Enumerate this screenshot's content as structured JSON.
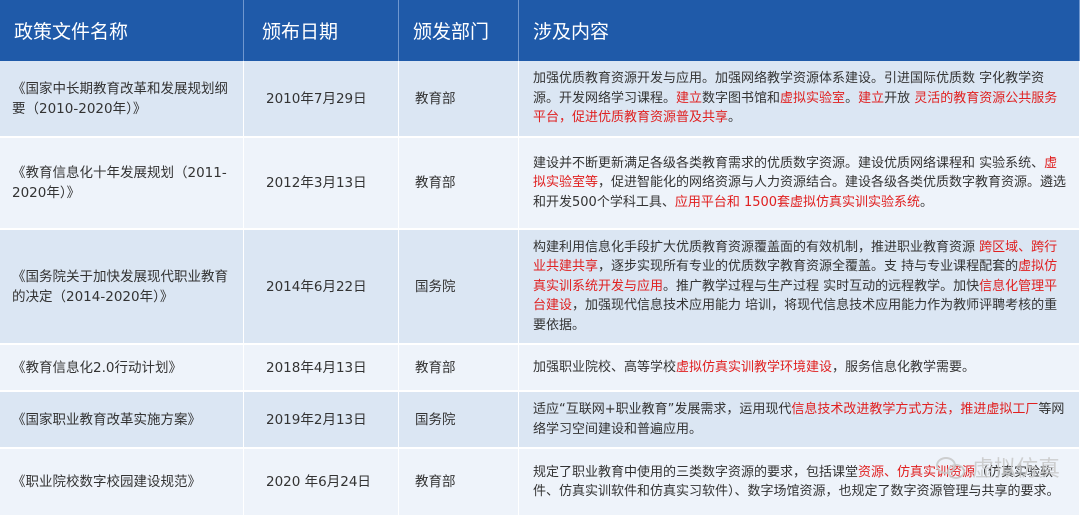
{
  "headers": [
    "政策文件名称",
    "颁布日期",
    "颁发部门",
    "涉及内容"
  ],
  "rows": [
    {
      "name": "《国家中长期教育改革和发展规划纲要（2010-2020年）》",
      "date": "2010年7月29日",
      "dept": "教育部",
      "content": [
        {
          "t": "加强优质教育资源开发与应用。加强网络教学资源体系建设。引进国际优质数 字化教学资源。开发网络学习课程。",
          "r": false
        },
        {
          "t": "建立",
          "r": true
        },
        {
          "t": "数字图书馆和",
          "r": false
        },
        {
          "t": "虚拟实验室",
          "r": true
        },
        {
          "t": "。",
          "r": false
        },
        {
          "t": "建立",
          "r": true
        },
        {
          "t": "开放 ",
          "r": false
        },
        {
          "t": "灵活的教育资源公共服务平台，促进优质教育资源普及共享",
          "r": true
        },
        {
          "t": "。",
          "r": false
        }
      ]
    },
    {
      "name": "《教育信息化十年发展规划（2011-2020年）》",
      "date": "2012年3月13日",
      "dept": "教育部",
      "content": [
        {
          "t": "建设并不断更新满足各级各类教育需求的优质数字资源。建设优质网络课程和 实验系统、",
          "r": false
        },
        {
          "t": "虚拟实验室等",
          "r": true
        },
        {
          "t": "，促进智能化的网络资源与人力资源结合。建设各级各类优质数字教育资源。遴选和开发500个学科工具、",
          "r": false
        },
        {
          "t": "应用平台和  1500套虚拟仿真实训实验系统",
          "r": true
        },
        {
          "t": "。",
          "r": false
        }
      ]
    },
    {
      "name": "《国务院关于加快发展现代职业教育的决定（2014-2020年）》",
      "date": "2014年6月22日",
      "dept": "国务院",
      "content": [
        {
          "t": "构建利用信息化手段扩大优质教育资源覆盖面的有效机制，推进职业教育资源 ",
          "r": false
        },
        {
          "t": "跨区域、跨行业共建共享",
          "r": true
        },
        {
          "t": "，逐步实现所有专业的优质数字教育资源全覆盖。支 持与专业课程配套的",
          "r": false
        },
        {
          "t": "虚拟仿真实训系统开发与应用",
          "r": true
        },
        {
          "t": "。推广教学过程与生产过程 实时互动的远程教学。加快",
          "r": false
        },
        {
          "t": "信息化管理平台建设",
          "r": true
        },
        {
          "t": "，加强现代信息技术应用能力 培训，将现代信息技术应用能力作为教师评聘考核的重要依据。",
          "r": false
        }
      ]
    },
    {
      "name": "《教育信息化2.0行动计划》",
      "date": "2018年4月13日",
      "dept": "教育部",
      "content": [
        {
          "t": "加强职业院校、高等学校",
          "r": false
        },
        {
          "t": "虚拟仿真实训教学环境建设",
          "r": true
        },
        {
          "t": "，服务信息化教学需要。",
          "r": false
        }
      ]
    },
    {
      "name": "《国家职业教育改革实施方案》",
      "date": "2019年2月13日",
      "dept": "国务院",
      "content": [
        {
          "t": "适应“互联网+职业教育”发展需求，运用现代",
          "r": false
        },
        {
          "t": "信息技术改进教学方式方法，推进虚拟工厂",
          "r": true
        },
        {
          "t": "等网络学习空间建设和普遍应用。",
          "r": false
        }
      ]
    },
    {
      "name": "《职业院校数字校园建设规范》",
      "date": "2020 年6月24日",
      "dept": "教育部",
      "content": [
        {
          "t": "规定了职业教育中使用的三类数字资源的要求，包括课堂",
          "r": false
        },
        {
          "t": "资源、仿真实训资源",
          "r": true
        },
        {
          "t": "（仿真实验软件、仿真实训软件和仿真实习软件）、数字场馆资源，也规定了数字资源管理与共享的要求。",
          "r": false
        }
      ]
    }
  ],
  "watermark": "虚拟仿真"
}
